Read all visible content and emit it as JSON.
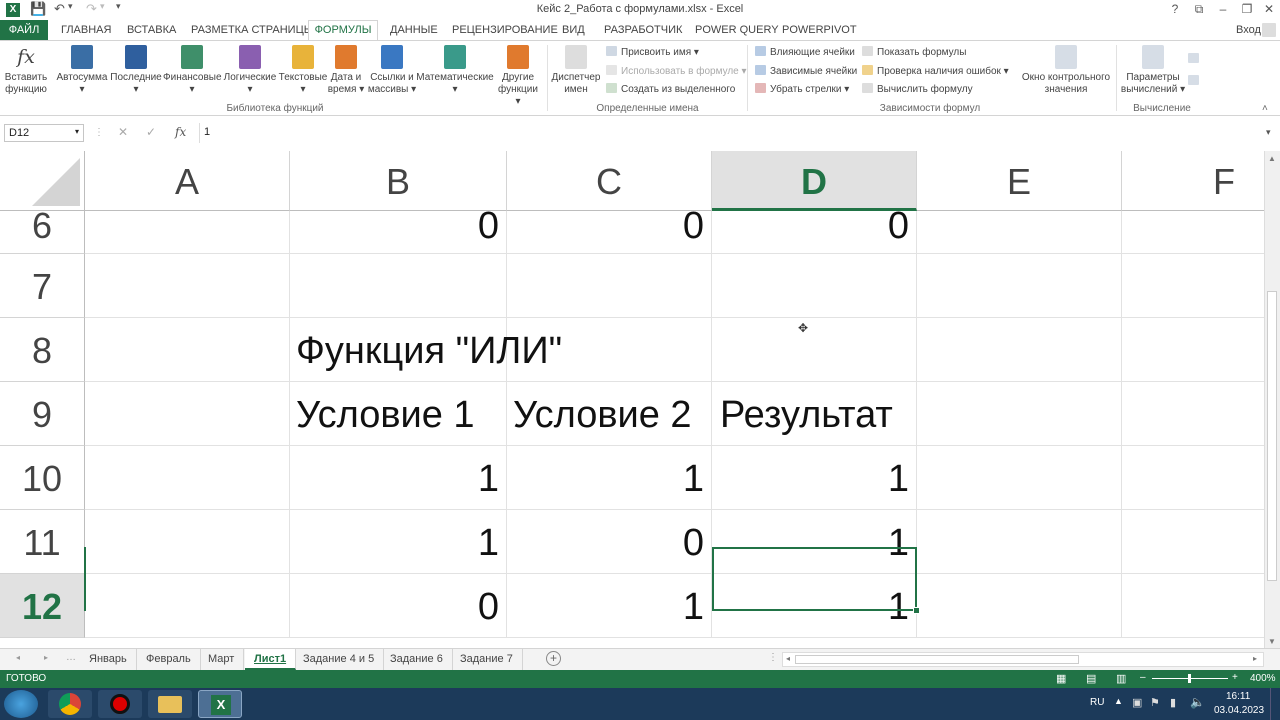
{
  "title": "Кейс 2_Работа с формулами.xlsx - Excel",
  "title_buttons": [
    "?",
    "⧉",
    "–",
    "❐",
    "✕"
  ],
  "login": "Вход",
  "tabs": {
    "file": "ФАЙЛ",
    "items": [
      "ГЛАВНАЯ",
      "ВСТАВКА",
      "РАЗМЕТКА СТРАНИЦЫ",
      "ФОРМУЛЫ",
      "ДАННЫЕ",
      "РЕЦЕНЗИРОВАНИЕ",
      "ВИД",
      "РАЗРАБОТЧИК",
      "POWER QUERY",
      "POWERPIVOT"
    ],
    "active": "ФОРМУЛЫ"
  },
  "ribbon": {
    "insert_function": [
      "Вставить",
      "функцию"
    ],
    "library": [
      {
        "l1": "Автосумма",
        "l2": "▾",
        "icon": "sigma-icon",
        "color": "#3a6ea5"
      },
      {
        "l1": "Последние",
        "l2": "▾",
        "icon": "star-book-icon",
        "color": "#2f5f9e"
      },
      {
        "l1": "Финансовые",
        "l2": "▾",
        "icon": "finance-book-icon",
        "color": "#3f8f6a"
      },
      {
        "l1": "Логические",
        "l2": "▾",
        "icon": "question-book-icon",
        "color": "#8a5fb0"
      },
      {
        "l1": "Текстовые",
        "l2": "▾",
        "icon": "text-book-icon",
        "color": "#e8b33a"
      },
      {
        "l1": "Дата и",
        "l2": "время ▾",
        "icon": "clock-book-icon",
        "color": "#e07a2e"
      },
      {
        "l1": "Ссылки и",
        "l2": "массивы ▾",
        "icon": "search-book-icon",
        "color": "#3a78c2"
      },
      {
        "l1": "Математические",
        "l2": "▾",
        "icon": "theta-book-icon",
        "color": "#3a9a8a"
      },
      {
        "l1": "Другие",
        "l2": "функции ▾",
        "icon": "more-book-icon",
        "color": "#e07a2e"
      }
    ],
    "library_group": "Библиотека функций",
    "name_manager": [
      "Диспетчер",
      "имен"
    ],
    "names_small": [
      "Присвоить имя  ▾",
      "Использовать в формуле ▾",
      "Создать из выделенного"
    ],
    "names_group": "Определенные имена",
    "audit_small_1": [
      "Влияющие ячейки",
      "Зависимые ячейки",
      "Убрать стрелки  ▾"
    ],
    "audit_small_2": [
      "Показать формулы",
      "Проверка наличия ошибок  ▾",
      "Вычислить формулу"
    ],
    "audit_group": "Зависимости формул",
    "watch": [
      "Окно контрольного",
      "значения"
    ],
    "calc_options": [
      "Параметры",
      "вычислений ▾"
    ],
    "calc_group": "Вычисление"
  },
  "formula_bar": {
    "name_box": "D12",
    "value": "1",
    "fx": "fx"
  },
  "columns": [
    "A",
    "B",
    "C",
    "D",
    "E",
    "F"
  ],
  "selected_column": "D",
  "rows": [
    {
      "num": "6",
      "cells": [
        "",
        "0",
        "0",
        "0",
        "",
        ""
      ]
    },
    {
      "num": "7",
      "cells": [
        "",
        "",
        "",
        "",
        "",
        ""
      ]
    },
    {
      "num": "8",
      "cells": [
        "",
        "Функция \"ИЛИ\"",
        "",
        "",
        "",
        ""
      ]
    },
    {
      "num": "9",
      "cells": [
        "",
        "Условие 1",
        "Условие 2",
        "Результат",
        "",
        ""
      ]
    },
    {
      "num": "10",
      "cells": [
        "",
        "1",
        "1",
        "1",
        "",
        ""
      ]
    },
    {
      "num": "11",
      "cells": [
        "",
        "1",
        "0",
        "1",
        "",
        ""
      ]
    },
    {
      "num": "12",
      "cells": [
        "",
        "0",
        "1",
        "1",
        "",
        ""
      ]
    }
  ],
  "selected_row": "12",
  "sheets": [
    "Январь",
    "Февраль",
    "Март",
    "Лист1",
    "Задание 4 и 5",
    "Задание 6",
    "Задание 7"
  ],
  "active_sheet": "Лист1",
  "status": {
    "mode": "ГОТОВО",
    "zoom": "400%"
  },
  "taskbar": {
    "lang": "RU",
    "time": "16:11",
    "date": "03.04.2023"
  },
  "colors": {
    "accent": "#217346",
    "taskbar": "#1c3a5a"
  }
}
